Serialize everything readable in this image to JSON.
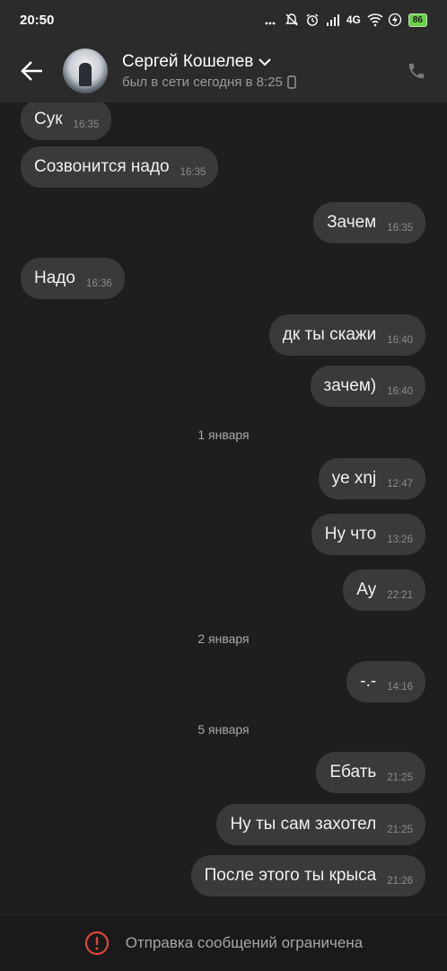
{
  "status_bar": {
    "time": "20:50",
    "network": "4G",
    "battery": "86",
    "icons": [
      "mute-icon",
      "alarm-icon",
      "signal-icon",
      "wifi-icon",
      "charging-icon",
      "battery-icon"
    ]
  },
  "header": {
    "contact_name": "Сергей Кошелев",
    "status": "был в сети сегодня в 8:25",
    "accent": "#ffffff"
  },
  "messages": [
    {
      "dir": "in",
      "text": "Сук",
      "time": "16:35"
    },
    {
      "dir": "in",
      "text": "Созвонится надо",
      "time": "16:35"
    },
    {
      "dir": "out",
      "text": "Зачем",
      "time": "16:35"
    },
    {
      "dir": "in",
      "text": "Надо",
      "time": "16:36"
    },
    {
      "dir": "out",
      "text": "дк ты скажи",
      "time": "16:40"
    },
    {
      "dir": "out",
      "text": "зачем)",
      "time": "16:40"
    },
    {
      "date": "1 января"
    },
    {
      "dir": "out",
      "text": "ye xnj",
      "time": "12:47"
    },
    {
      "dir": "out",
      "text": "Ну что",
      "time": "13:26"
    },
    {
      "dir": "out",
      "text": "Ау",
      "time": "22:21"
    },
    {
      "date": "2 января"
    },
    {
      "dir": "out",
      "text": "-.-",
      "time": "14:16"
    },
    {
      "date": "5 января"
    },
    {
      "dir": "out",
      "text": "Ебать",
      "time": "21:25"
    },
    {
      "dir": "out",
      "text": "Ну ты сам захотел",
      "time": "21:25"
    },
    {
      "dir": "out",
      "text": "После этого ты крыса",
      "time": "21:26"
    }
  ],
  "footer": {
    "restriction_text": "Отправка сообщений ограничена",
    "warning_color": "#e0463d"
  }
}
